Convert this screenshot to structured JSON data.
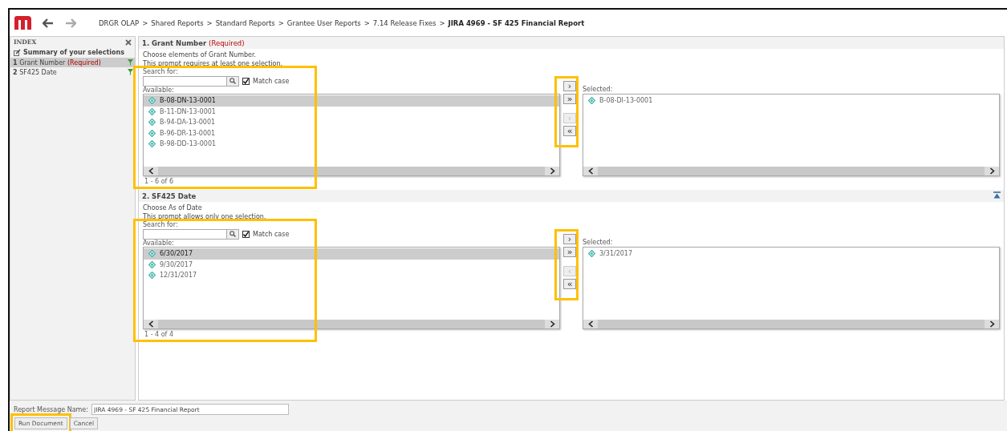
{
  "header": {
    "breadcrumb": [
      {
        "label": "DRGR OLAP",
        "separator": ">"
      },
      {
        "label": "Shared Reports",
        "separator": ">"
      },
      {
        "label": "Standard Reports",
        "separator": ">"
      },
      {
        "label": "Grantee User Reports",
        "separator": ">"
      },
      {
        "label": "7.14 Release Fixes",
        "separator": ">"
      }
    ],
    "current": "JIRA 4969 - SF 425 Financial Report"
  },
  "index": {
    "title": "INDEX",
    "summary": "Summary of your selections",
    "items": [
      {
        "number": "1",
        "label": "Grant Number",
        "required": "(Required)",
        "selected": true
      },
      {
        "number": "2",
        "label": "SF425 Date",
        "selected": false
      }
    ]
  },
  "prompts": [
    {
      "number": "1.",
      "title": "Grant Number",
      "required": "(Required)",
      "description": "Choose elements of Grant Number.",
      "rule": "This prompt requires at least one selection.",
      "search_label": "Search for:",
      "match_case": {
        "label": "Match case",
        "checked": true
      },
      "available_label": "Available:",
      "available": [
        {
          "label": "B-08-DN-13-0001",
          "selected": true
        },
        {
          "label": "B-11-DN-13-0001",
          "selected": false
        },
        {
          "label": "B-94-DA-13-0001",
          "selected": false
        },
        {
          "label": "B-96-DR-13-0001",
          "selected": false
        },
        {
          "label": "B-98-DD-13-0001",
          "selected": false
        }
      ],
      "count": "1 - 6 of 6",
      "move_buttons": [
        {
          "symbol": "›",
          "disabled": false
        },
        {
          "symbol": "»",
          "disabled": false
        },
        {
          "symbol": "‹",
          "disabled": true
        },
        {
          "symbol": "«",
          "disabled": false
        }
      ],
      "selected_label": "Selected:",
      "selected_items": [
        "B-08-DI-13-0001"
      ],
      "collapse_icon": false,
      "highlighted": true
    },
    {
      "number": "2.",
      "title": "SF425 Date",
      "description": "Choose As of Date",
      "rule": "This prompt allows only one selection.",
      "search_label": "Search for:",
      "match_case": {
        "label": "Match case",
        "checked": true
      },
      "available_label": "Available:",
      "available": [
        {
          "label": "6/30/2017",
          "selected": true
        },
        {
          "label": "9/30/2017",
          "selected": false
        },
        {
          "label": "12/31/2017",
          "selected": false
        }
      ],
      "count": "1 - 4 of 4",
      "move_buttons": [
        {
          "symbol": "›",
          "disabled": false
        },
        {
          "symbol": "»",
          "disabled": false
        },
        {
          "symbol": "‹",
          "disabled": true
        },
        {
          "symbol": "«",
          "disabled": false
        }
      ],
      "selected_label": "Selected:",
      "selected_items": [
        "3/31/2017"
      ],
      "collapse_icon": true,
      "highlighted": true
    }
  ],
  "report_name": {
    "label": "Report Message Name:",
    "value": "JIRA 4969 - SF 425 Financial Report"
  },
  "buttons": [
    {
      "label": "Run Document",
      "highlighted": true
    },
    {
      "label": "Cancel",
      "highlighted": false
    }
  ]
}
